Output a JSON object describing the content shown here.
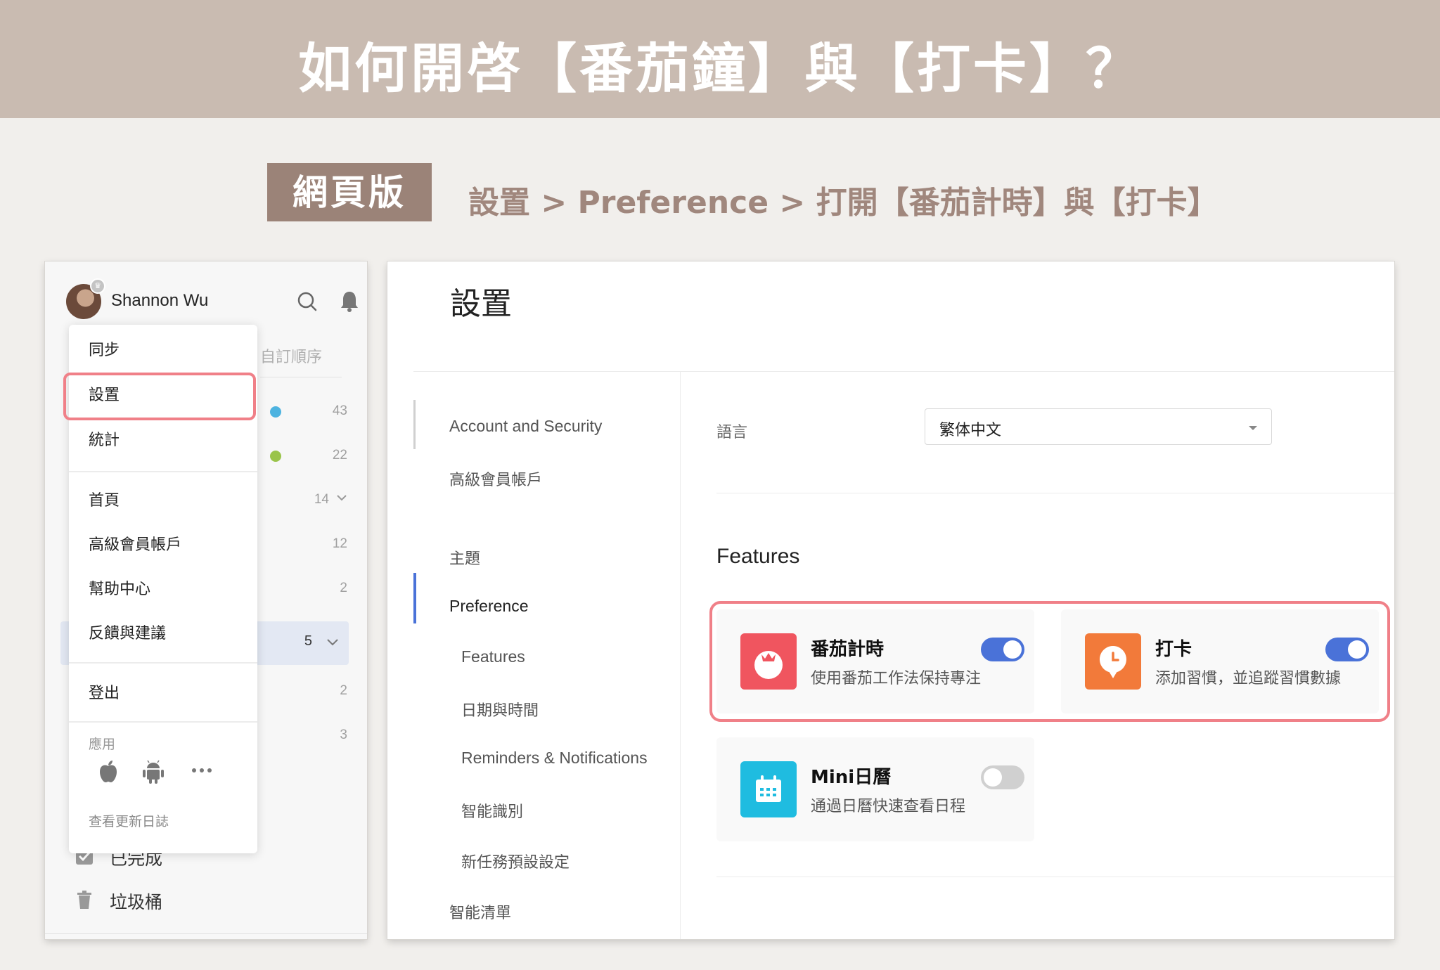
{
  "banner": {
    "title": "如何開啓【番茄鐘】與【打卡】？"
  },
  "subtitle": {
    "tag": "網頁版",
    "path": "設置 > Preference > 打開【番茄計時】與【打卡】"
  },
  "left_panel": {
    "user": {
      "name": "Shannon Wu"
    },
    "background_list": {
      "sort_label": "自訂順序",
      "rows": [
        {
          "count": "43",
          "dot_color": "#4db3e0"
        },
        {
          "count": "22",
          "dot_color": "#9ac44a"
        },
        {
          "count": "14"
        },
        {
          "count": "12"
        },
        {
          "count": "2"
        },
        {
          "count": "5"
        },
        {
          "count": "2"
        },
        {
          "count": "3"
        }
      ],
      "completed_label": "已完成",
      "trash_label": "垃圾桶"
    },
    "menu": {
      "items": [
        "同步",
        "設置",
        "統計",
        "首頁",
        "高級會員帳戶",
        "幫助中心",
        "反饋與建議",
        "登出"
      ],
      "highlighted": "設置",
      "app_label": "應用",
      "changelog_label": "查看更新日誌",
      "app_icons": [
        "apple-icon",
        "android-icon",
        "more-icon"
      ]
    }
  },
  "settings": {
    "title": "設置",
    "nav": {
      "items": [
        "Account and Security",
        "高級會員帳戶",
        "主題",
        "Preference",
        "Features",
        "日期與時間",
        "Reminders & Notifications",
        "智能識別",
        "新任務預設設定",
        "智能清單"
      ],
      "active": "Preference"
    },
    "language": {
      "label": "語言",
      "value": "繁体中文"
    },
    "features": {
      "heading": "Features",
      "cards": [
        {
          "name": "番茄計時",
          "description": "使用番茄工作法保持專注",
          "enabled": true,
          "icon_color": "#f0555f",
          "icon": "tomato-icon"
        },
        {
          "name": "打卡",
          "description": "添加習慣，並追蹤習慣數據",
          "enabled": true,
          "icon_color": "#f27a3a",
          "icon": "habit-clock-icon"
        },
        {
          "name": "Mini日曆",
          "description": "通過日曆快速查看日程",
          "enabled": false,
          "icon_color": "#1fbce0",
          "icon": "calendar-icon"
        }
      ]
    },
    "accent_color": "#4a72d8",
    "highlight_color": "#f08088"
  }
}
